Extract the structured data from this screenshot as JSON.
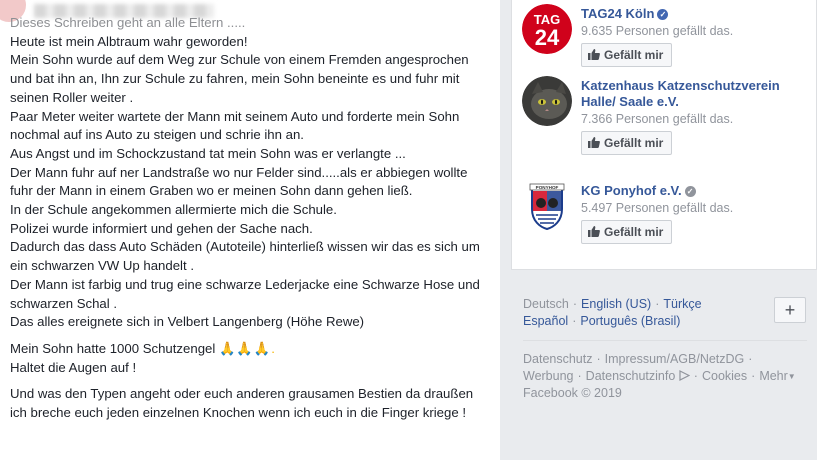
{
  "post": {
    "paragraphs": [
      "Dieses Schreiben geht an alle Eltern .....",
      "Heute ist mein Albtraum wahr geworden!",
      "Mein Sohn wurde auf dem Weg zur Schule von einem Fremden angesprochen und bat ihn an, Ihn zur Schule zu fahren, mein Sohn beneinte es und fuhr mit seinen Roller weiter .",
      "Paar Meter weiter wartete der Mann mit seinem Auto und forderte mein Sohn nochmal auf ins Auto zu steigen und schrie ihn an.",
      "Aus Angst und im Schockzustand tat mein Sohn was er verlangte ...",
      "Der Mann fuhr auf ner Landstraße wo nur Felder sind.....als er abbiegen wollte fuhr der Mann in einem Graben wo er meinen Sohn dann gehen ließ.",
      "In der Schule angekommen allermierte mich die Schule.",
      "Polizei wurde informiert und gehen der Sache nach.",
      "Dadurch das dass Auto Schäden (Autoteile) hinterließ wissen wir das es sich um ein schwarzen VW Up handelt .",
      "Der Mann ist farbig und trug eine schwarze Lederjacke eine Schwarze Hose und schwarzen Schal .",
      "Das alles ereignete sich in Velbert Langenberg (Höhe Rewe)"
    ],
    "closing1_text": "Mein Sohn hatte 1000 Schutzengel",
    "closing1_emoji": "🙏🙏🙏.",
    "closing2": "Haltet die Augen auf !",
    "closing3": "Und was den Typen angeht oder euch anderen grausamen Bestien da draußen ich breche euch jeden einzelnen Knochen wenn ich euch in die Finger kriege !"
  },
  "pages": [
    {
      "name": "TAG24 Köln",
      "verified": true,
      "likes": "9.635 Personen gefällt das.",
      "button": "Gefällt mir",
      "logo_text": "TAG 24"
    },
    {
      "name": "Katzenhaus Katzenschutzverein Halle/ Saale e.V.",
      "verified": false,
      "likes": "7.366 Personen gefällt das.",
      "button": "Gefällt mir"
    },
    {
      "name": "KG Ponyhof e.V.",
      "verified": true,
      "likes": "5.497 Personen gefällt das.",
      "button": "Gefällt mir",
      "logo_text": "PONYHOF"
    }
  ],
  "footer": {
    "languages": [
      "Deutsch",
      "English (US)",
      "Türkçe",
      "Español",
      "Português (Brasil)"
    ],
    "links": [
      "Datenschutz",
      "Impressum/AGB/NetzDG",
      "Werbung",
      "Datenschutzinfo",
      "Cookies",
      "Mehr"
    ],
    "copyright": "Facebook © 2019",
    "plus_label": "+"
  },
  "colors": {
    "link": "#365899",
    "muted": "#90949c",
    "verified": "#4267b2",
    "tag24_red": "#d0021b"
  }
}
